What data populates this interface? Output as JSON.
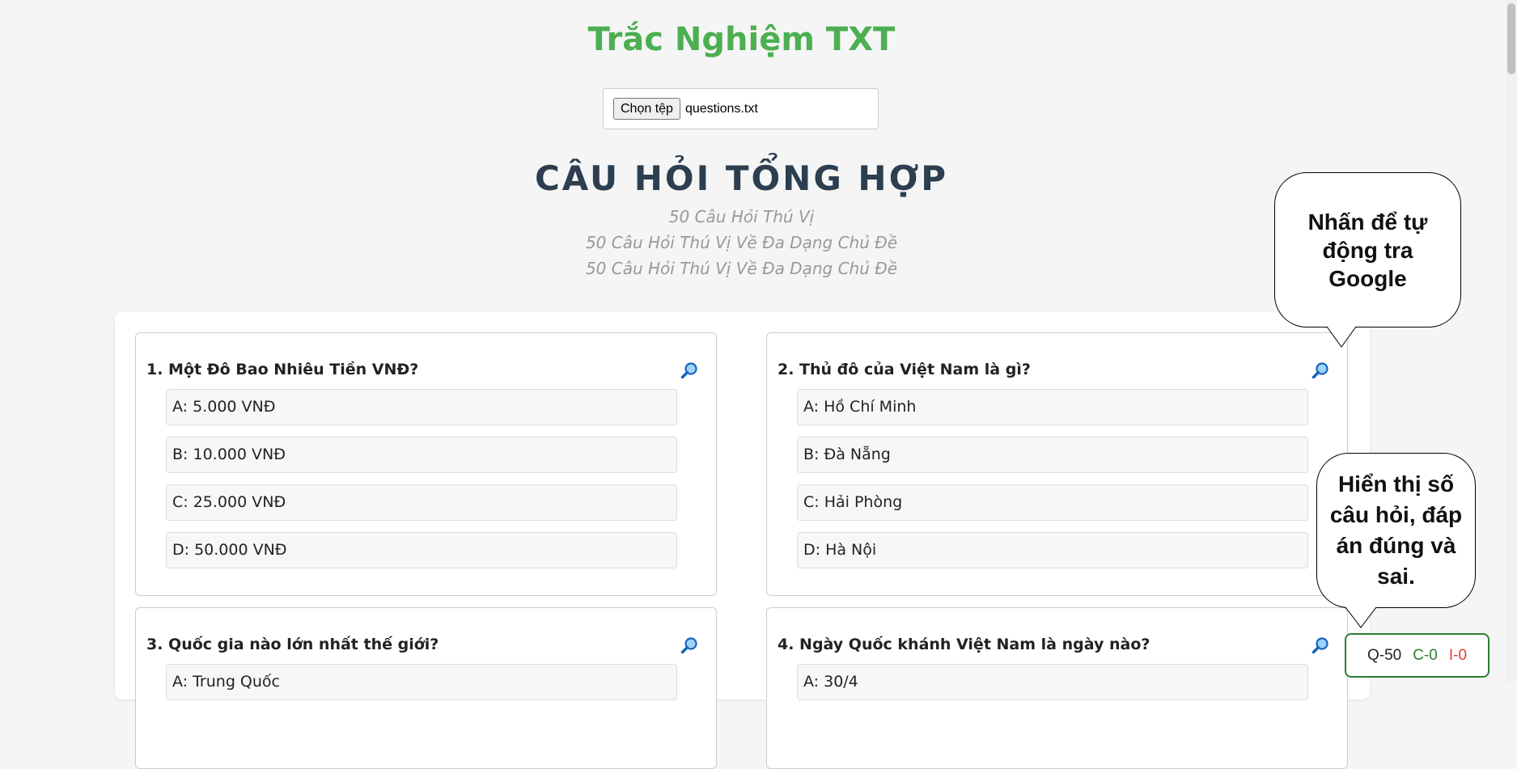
{
  "app": {
    "title": "Trắc Nghiệm TXT"
  },
  "file_picker": {
    "button_label": "Chọn tệp",
    "file_name": "questions.txt"
  },
  "quiz": {
    "heading": "CÂU HỎI TỔNG HỢP",
    "subtitles": [
      "50 Câu Hỏi Thú Vị",
      "50 Câu Hỏi Thú Vị Về Đa Dạng Chủ Đề",
      "50 Câu Hỏi Thú Vị Về Đa Dạng Chủ Đề"
    ],
    "questions": [
      {
        "title": "1. Một Đô Bao Nhiêu Tiền VNĐ?",
        "options": [
          "A: 5.000 VNĐ",
          "B: 10.000 VNĐ",
          "C: 25.000 VNĐ",
          "D: 50.000 VNĐ"
        ]
      },
      {
        "title": "2. Thủ đô của Việt Nam là gì?",
        "options": [
          "A: Hồ Chí Minh",
          "B: Đà Nẵng",
          "C: Hải Phòng",
          "D: Hà Nội"
        ]
      },
      {
        "title": "3. Quốc gia nào lớn nhất thế giới?",
        "options": [
          "A: Trung Quốc"
        ]
      },
      {
        "title": "4. Ngày Quốc khánh Việt Nam là ngày nào?",
        "options": [
          "A: 30/4"
        ]
      }
    ]
  },
  "tooltips": {
    "search": "Nhấn để tự động tra Google",
    "counter": "Hiển thị số câu hỏi, đáp án đúng và sai."
  },
  "counter": {
    "total": "Q-50",
    "correct": "C-0",
    "incorrect": "I-0"
  },
  "colors": {
    "accent": "#4caf50",
    "heading": "#2c3e50",
    "correct": "#2e7d32",
    "incorrect": "#e53935"
  },
  "icons": {
    "search": "search-icon"
  }
}
